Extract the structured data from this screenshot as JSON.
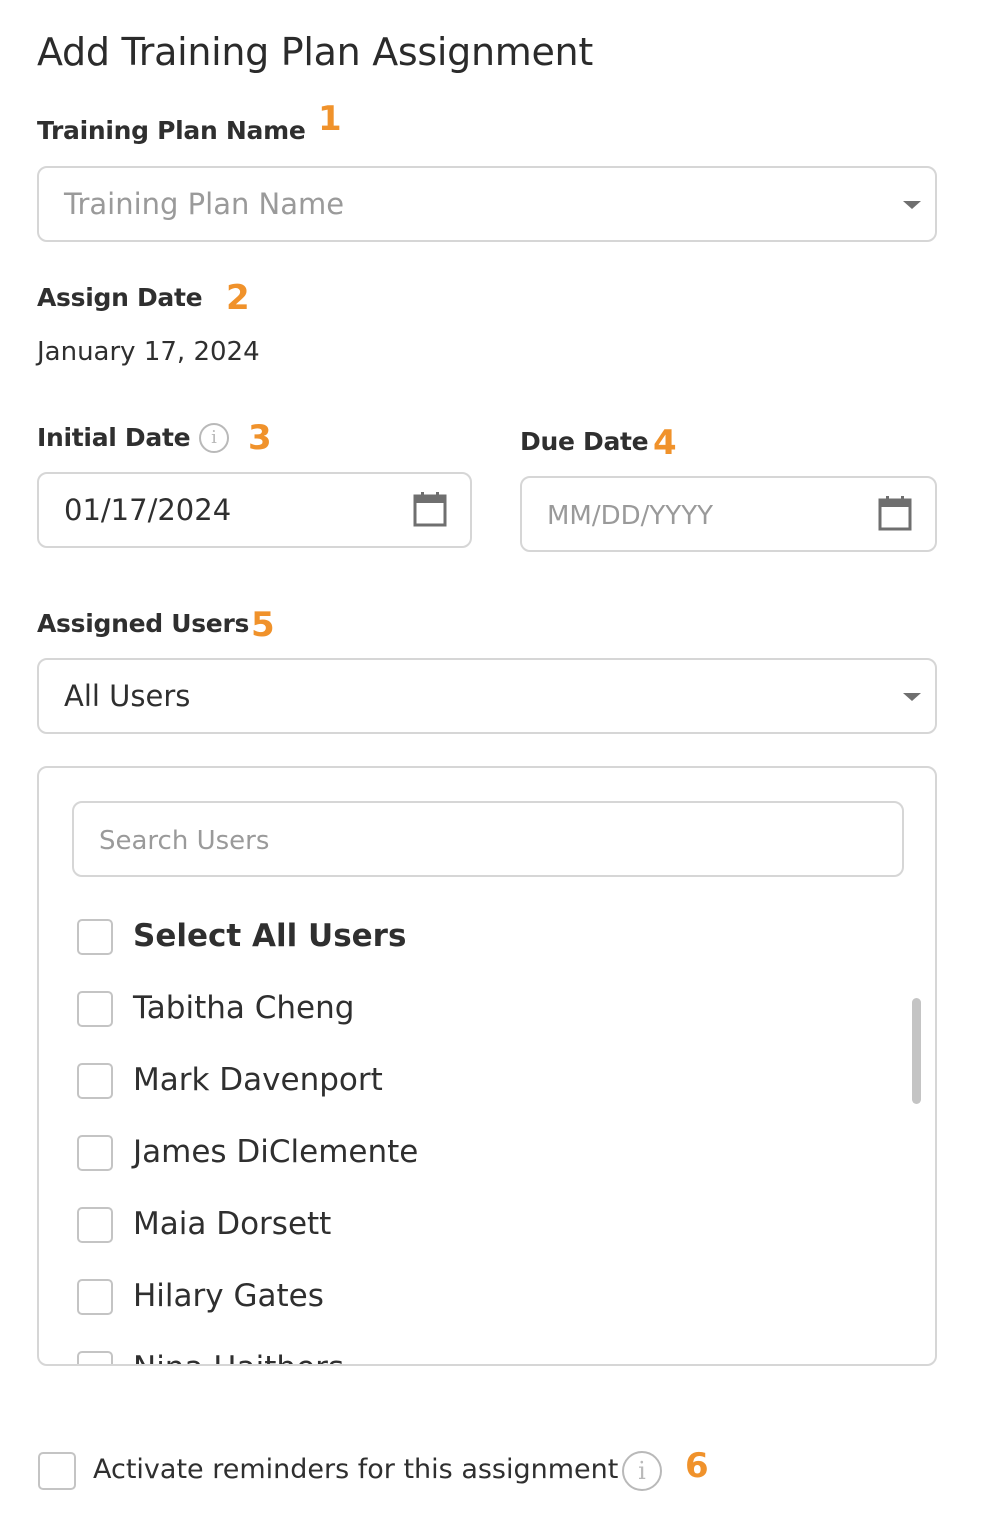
{
  "page": {
    "title": "Add Training Plan Assignment"
  },
  "training_plan": {
    "label": "Training Plan Name",
    "step": "1",
    "placeholder": "Training Plan Name",
    "icon": "chevron-down-icon"
  },
  "assign_date": {
    "label": "Assign Date",
    "step": "2",
    "value": "January 17, 2024"
  },
  "initial_date": {
    "label": "Initial Date",
    "step": "3",
    "info_icon_glyph": "i",
    "value": "01/17/2024",
    "icon": "calendar-icon"
  },
  "due_date": {
    "label": "Due Date",
    "step": "4",
    "placeholder": "MM/DD/YYYY",
    "icon": "calendar-icon"
  },
  "assigned_users": {
    "label": "Assigned Users",
    "step": "5",
    "selected": "All Users",
    "search_placeholder": "Search Users",
    "select_all_label": "Select All Users",
    "users": [
      "Tabitha Cheng",
      "Mark Davenport",
      "James DiClemente",
      "Maia Dorsett",
      "Hilary Gates",
      "Nina Haithers"
    ]
  },
  "reminders": {
    "label": "Activate reminders for this assignment",
    "step": "6",
    "info_icon_glyph": "i",
    "checked": false
  },
  "colors": {
    "accent_step": "#f0922b",
    "border": "#d6d6d6",
    "placeholder_text": "#9a9a9a"
  }
}
